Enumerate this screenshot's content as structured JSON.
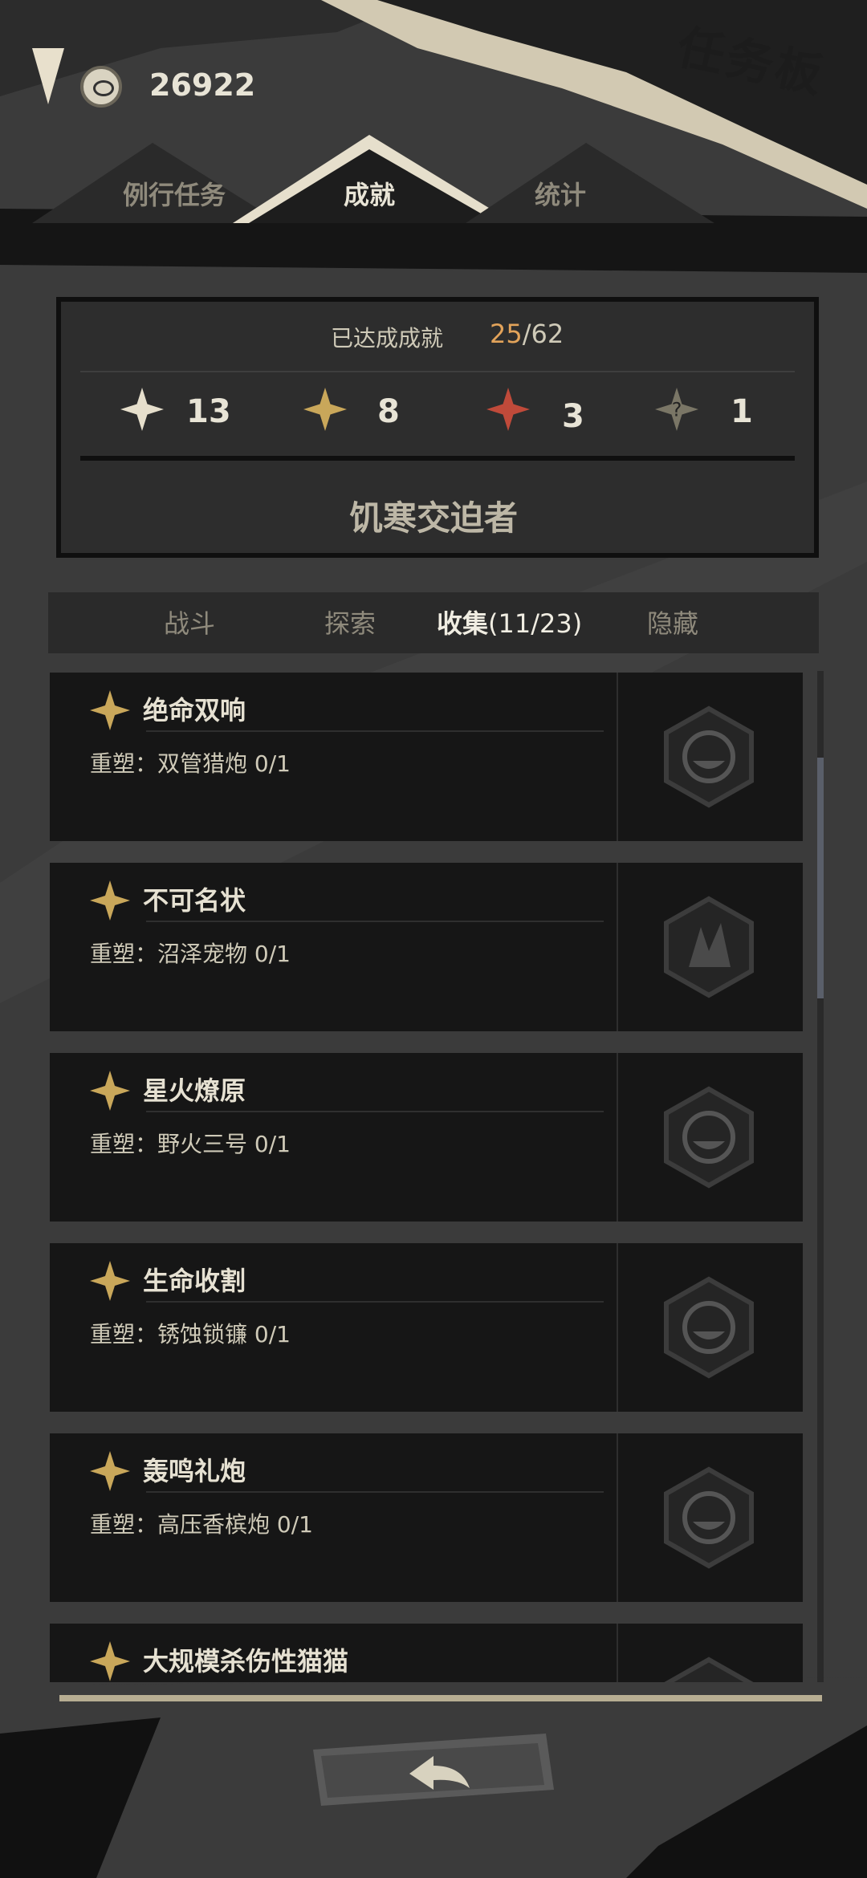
{
  "header": {
    "title": "任务板",
    "currency_value": "26922",
    "currency_icon": "coin-icon"
  },
  "tabs": [
    {
      "label": "例行任务",
      "active": false
    },
    {
      "label": "成就",
      "active": true
    },
    {
      "label": "统计",
      "active": false
    }
  ],
  "summary": {
    "achieved_label": "已达成成就",
    "achieved_value": "25",
    "achieved_total": "/62",
    "stats": [
      {
        "icon": "white-star-icon",
        "color": "#e6dfcc",
        "value": "13"
      },
      {
        "icon": "gold-star-icon",
        "color": "#c9a75a",
        "value": "8"
      },
      {
        "icon": "red-star-icon",
        "color": "#c04a3a",
        "value": "3"
      },
      {
        "icon": "hidden-star-icon",
        "color": "#7a7666",
        "value": "1"
      }
    ],
    "rank_title": "饥寒交迫者"
  },
  "categories": [
    {
      "label": "战斗",
      "active": false
    },
    {
      "label": "探索",
      "active": false
    },
    {
      "label": "收集",
      "count": "(11/23)",
      "active": true
    },
    {
      "label": "隐藏",
      "active": false
    }
  ],
  "achievements": [
    {
      "name": "绝命双响",
      "requirement": "重塑：双管猎炮 0/1",
      "badge_icon": "cannon-badge-icon"
    },
    {
      "name": "不可名状",
      "requirement": "重塑：沼泽宠物 0/1",
      "badge_icon": "creature-badge-icon"
    },
    {
      "name": "星火燎原",
      "requirement": "重塑：野火三号 0/1",
      "badge_icon": "cannon-badge-icon"
    },
    {
      "name": "生命收割",
      "requirement": "重塑：锈蚀锁镰 0/1",
      "badge_icon": "cannon-badge-icon"
    },
    {
      "name": "轰鸣礼炮",
      "requirement": "重塑：高压香槟炮 0/1",
      "badge_icon": "cannon-badge-icon"
    },
    {
      "name": "大规模杀伤性猫猫",
      "requirement": "",
      "badge_icon": "cannon-badge-icon"
    }
  ],
  "colors": {
    "accent_gold": "#c9a75a",
    "accent_orange": "#e2a35a",
    "card_bg": "#161616"
  },
  "back_icon": "back-arrow-icon"
}
